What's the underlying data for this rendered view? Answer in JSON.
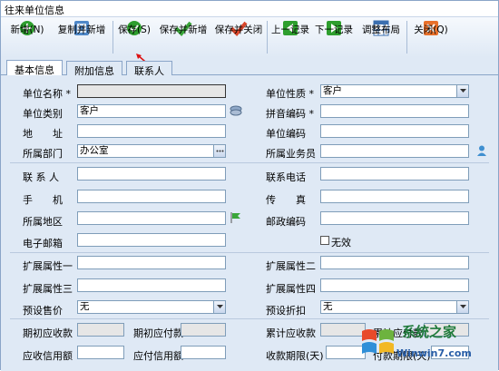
{
  "window": {
    "title": "往来单位信息"
  },
  "toolbar": {
    "new": "新增(N)",
    "copy_new": "复制并新增",
    "save": "保存(S)",
    "save_new": "保存并新增",
    "save_close": "保存并关闭",
    "prev": "上一记录",
    "next": "下一记录",
    "layout": "调整布局",
    "close": "关闭(Q)"
  },
  "tabs": [
    "基本信息",
    "附加信息",
    "联系人"
  ],
  "form": {
    "unit_name": {
      "label": "单位名称 *",
      "value": ""
    },
    "unit_nature": {
      "label": "单位性质 *",
      "value": "客户"
    },
    "unit_category": {
      "label": "单位类别",
      "value": "客户"
    },
    "pinyin_code": {
      "label": "拼音编码 *",
      "value": ""
    },
    "address": {
      "label": "地　　址",
      "value": ""
    },
    "unit_code": {
      "label": "单位编码",
      "value": ""
    },
    "department": {
      "label": "所属部门",
      "value": "办公室"
    },
    "salesperson": {
      "label": "所属业务员",
      "value": ""
    },
    "contact": {
      "label": "联 系 人",
      "value": ""
    },
    "phone": {
      "label": "联系电话",
      "value": ""
    },
    "mobile": {
      "label": "手　　机",
      "value": ""
    },
    "fax": {
      "label": "传　　真",
      "value": ""
    },
    "region": {
      "label": "所属地区",
      "value": ""
    },
    "postal": {
      "label": "邮政编码",
      "value": ""
    },
    "email": {
      "label": "电子邮箱",
      "value": ""
    },
    "invalid": {
      "label": "无效"
    },
    "ext1": {
      "label": "扩展属性一",
      "value": ""
    },
    "ext2": {
      "label": "扩展属性二",
      "value": ""
    },
    "ext3": {
      "label": "扩展属性三",
      "value": ""
    },
    "ext4": {
      "label": "扩展属性四",
      "value": ""
    },
    "preset_price": {
      "label": "预设售价",
      "value": "无"
    },
    "preset_discount": {
      "label": "预设折扣",
      "value": "无"
    },
    "init_receivable": {
      "label": "期初应收款",
      "value": ""
    },
    "init_payable": {
      "label": "期初应付款",
      "value": ""
    },
    "cum_receivable": {
      "label": "累计应收款",
      "value": ""
    },
    "cum_payable": {
      "label": "累计应付款",
      "value": ""
    },
    "recv_credit": {
      "label": "应收信用额",
      "value": ""
    },
    "pay_credit": {
      "label": "应付信用额",
      "value": ""
    },
    "recv_term": {
      "label": "收款期限(天)",
      "value": ""
    },
    "pay_term": {
      "label": "付款期限(天)",
      "value": ""
    }
  },
  "watermark": {
    "brand": "系统之家",
    "url": "Winwin7.com"
  },
  "colors": {
    "green": "#2e9e2e",
    "orange": "#e8702a",
    "teal": "#2a8f8f"
  }
}
